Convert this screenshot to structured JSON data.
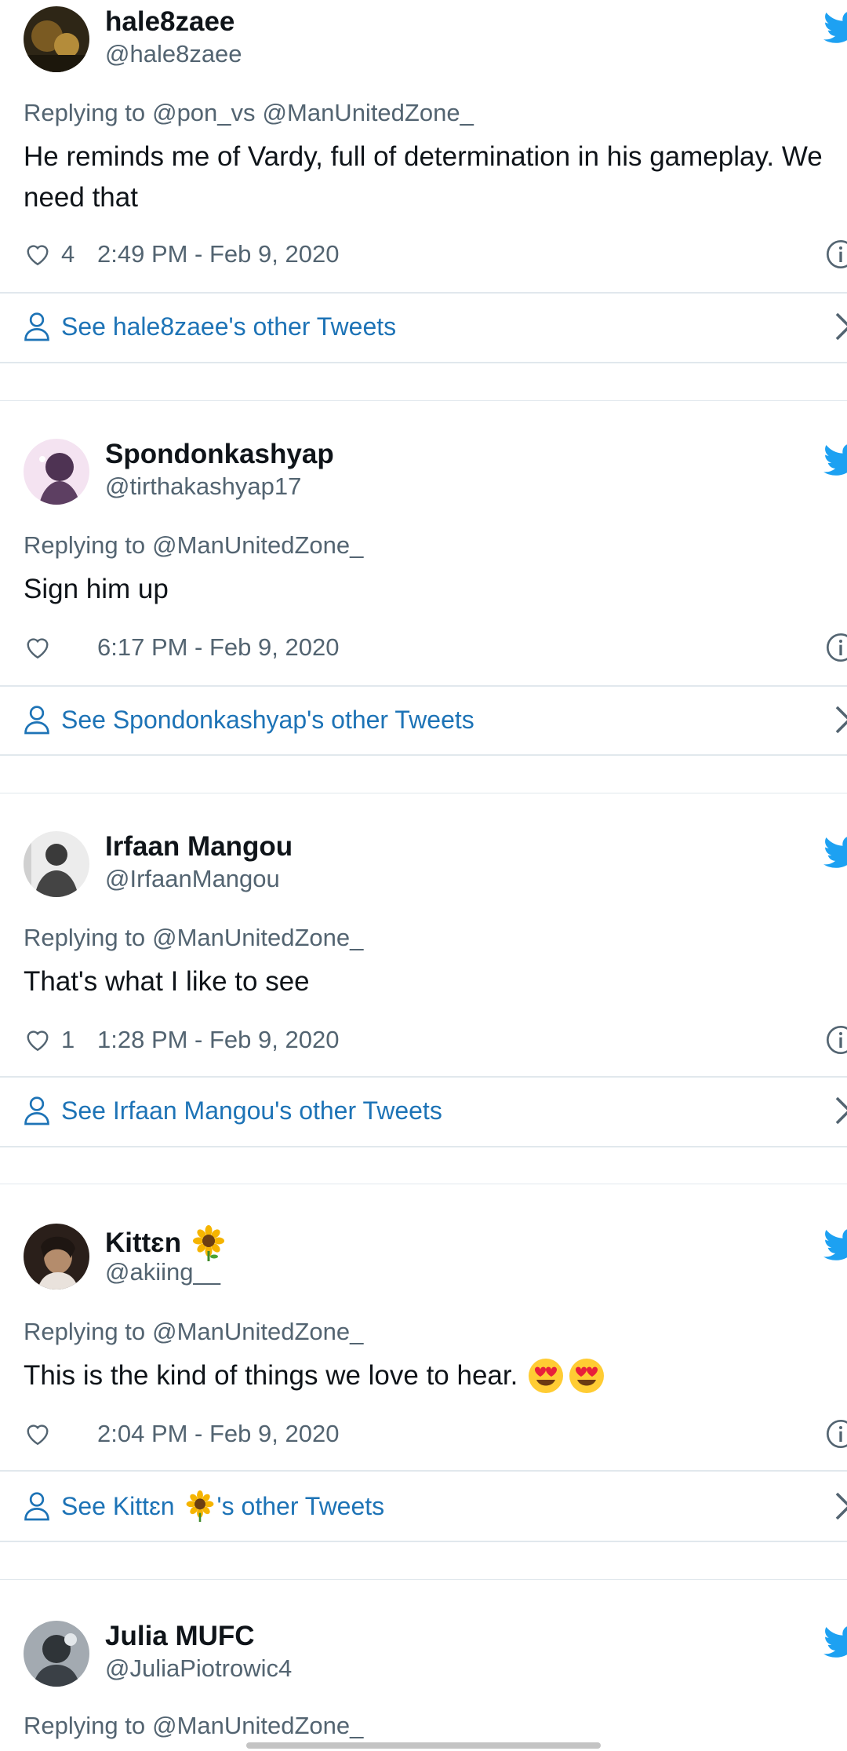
{
  "tweets": [
    {
      "name": "hale8zaee",
      "handle": "@hale8zaee",
      "replying_label": "Replying to",
      "mentions": [
        "@pon_vs",
        "@ManUnitedZone_"
      ],
      "text": "He reminds me of Vardy, full of determination in his gameplay. We need that",
      "likes": "4",
      "time": "2:49 PM - Feb 9, 2020",
      "see_link": "See hale8zaee's other Tweets",
      "avatar_colors": [
        "#3a2e1a",
        "#8a6a2a"
      ]
    },
    {
      "name": "Spondonkashyap",
      "handle": "@tirthakashyap17",
      "replying_label": "Replying to",
      "mentions": [
        "@ManUnitedZone_"
      ],
      "text": "Sign him up",
      "likes": "",
      "time": "6:17 PM - Feb 9, 2020",
      "see_link": "See Spondonkashyap's other Tweets",
      "avatar_colors": [
        "#f3dcef",
        "#5a3b5f"
      ]
    },
    {
      "name": "Irfaan Mangou",
      "handle": "@IrfaanMangou",
      "replying_label": "Replying to",
      "mentions": [
        "@ManUnitedZone_"
      ],
      "text": "That's what I like to see",
      "likes": "1",
      "time": "1:28 PM - Feb 9, 2020",
      "see_link": "See Irfaan Mangou's other Tweets",
      "avatar_colors": [
        "#e6e6e6",
        "#3d3d3d"
      ]
    },
    {
      "name": "Kittɛn",
      "handle": "@akiing__",
      "replying_label": "Replying to",
      "mentions": [
        "@ManUnitedZone_"
      ],
      "text": "This is the kind of things we love to hear.",
      "likes": "",
      "time": "2:04 PM - Feb 9, 2020",
      "see_link_prefix": "See Kittɛn",
      "see_link_suffix": "'s other Tweets",
      "avatar_colors": [
        "#2b211c",
        "#b08a6a"
      ]
    },
    {
      "name": "Julia MUFC",
      "handle": "@JuliaPiotrowic4",
      "replying_label": "Replying to",
      "mentions": [
        "@ManUnitedZone_"
      ],
      "avatar_colors": [
        "#9aa1a8",
        "#2f3438"
      ]
    }
  ],
  "colors": {
    "link": "#1d73b6",
    "twitter_blue": "#1da1f2",
    "muted": "#536471",
    "divider": "#e1e8ed"
  },
  "icons": [
    "twitter-bird-icon",
    "heart-icon",
    "info-icon",
    "person-icon",
    "chevron-right-icon",
    "sunflower-emoji",
    "heart-eyes-emoji"
  ]
}
